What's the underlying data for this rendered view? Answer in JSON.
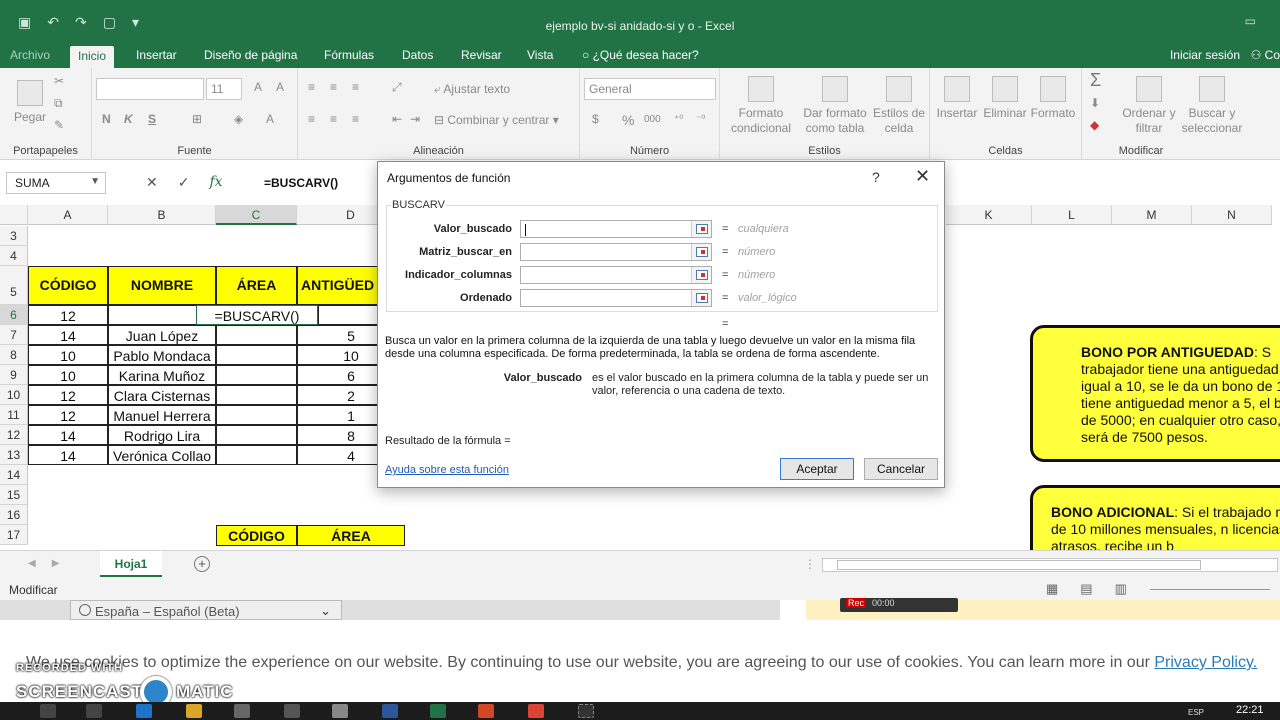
{
  "window": {
    "title": "ejemplo bv-si anidado-si y o - Excel"
  },
  "tabs": {
    "file": "Archivo",
    "items": [
      "Inicio",
      "Insertar",
      "Diseño de página",
      "Fórmulas",
      "Datos",
      "Revisar",
      "Vista",
      "¿Qué desea hacer?"
    ],
    "signin": "Iniciar sesión",
    "share": "Co"
  },
  "ribbon": {
    "clipboard": {
      "paste": "Pegar",
      "label": "Portapapeles"
    },
    "font": {
      "size": "11",
      "label": "Fuente",
      "bold": "N",
      "italic": "K",
      "underline": "S"
    },
    "alignment": {
      "wrap": "Ajustar texto",
      "merge": "Combinar y centrar",
      "label": "Alineación"
    },
    "number": {
      "format": "General",
      "label": "Número",
      "percent": "%",
      "thousands": "000"
    },
    "styles": {
      "conditional": "Formato condicional",
      "table": "Dar formato como tabla",
      "cell": "Estilos de celda",
      "label": "Estilos"
    },
    "cells": {
      "insert": "Insertar",
      "delete": "Eliminar",
      "format": "Formato",
      "label": "Celdas"
    },
    "editing": {
      "sort": "Ordenar y filtrar",
      "find": "Buscar y seleccionar",
      "label": "Modificar",
      "sum": "Σ"
    }
  },
  "formula_bar": {
    "name_box": "SUMA",
    "formula": "=BUSCARV()",
    "fx": "fx"
  },
  "sheet": {
    "columns": [
      "A",
      "B",
      "C",
      "D",
      "K",
      "L",
      "M",
      "N"
    ],
    "rows": [
      "3",
      "4",
      "5",
      "6",
      "7",
      "8",
      "9",
      "10",
      "11",
      "12",
      "13",
      "14",
      "15",
      "16",
      "17"
    ],
    "headers": [
      "CÓDIGO",
      "NOMBRE",
      "ÁREA",
      "ANTIGÜED"
    ],
    "editing_cell": "=BUSCARV()",
    "first_code": "12",
    "data": [
      {
        "codigo": "14",
        "nombre": "Juan López",
        "antiguedad": "5"
      },
      {
        "codigo": "10",
        "nombre": "Pablo Mondaca",
        "antiguedad": "10"
      },
      {
        "codigo": "10",
        "nombre": "Karina Muñoz",
        "antiguedad": "6"
      },
      {
        "codigo": "12",
        "nombre": "Clara Cisternas",
        "antiguedad": "2"
      },
      {
        "codigo": "12",
        "nombre": "Manuel Herrera",
        "antiguedad": "1"
      },
      {
        "codigo": "14",
        "nombre": "Rodrigo Lira",
        "antiguedad": "8"
      },
      {
        "codigo": "14",
        "nombre": "Verónica Collao",
        "antiguedad": "4"
      }
    ],
    "lookup_headers": [
      "CÓDIGO",
      "ÁREA"
    ],
    "bono1": {
      "title": "BONO POR ANTIGUEDAD",
      "text": ": S trabajador tiene una antiguedad m igual a 10, se le da un bono de 10 tiene antiguedad menor a 5, el bon de 5000; en cualquier otro caso, e será de 7500 pesos."
    },
    "bono2": {
      "title": "BONO ADICIONAL",
      "text": ": Si el trabajado más de 10 millones mensuales, n licencias ni atrasos, recibe un b"
    },
    "tab_name": "Hoja1"
  },
  "status": {
    "mode": "Modificar"
  },
  "dialog": {
    "title": "Argumentos de función",
    "help": "?",
    "function_name": "BUSCARV",
    "args": [
      {
        "label": "Valor_buscado",
        "hint": "cualquiera"
      },
      {
        "label": "Matriz_buscar_en",
        "hint": "número"
      },
      {
        "label": "Indicador_columnas",
        "hint": "número"
      },
      {
        "label": "Ordenado",
        "hint": "valor_lógico"
      }
    ],
    "equals": "=",
    "description": "Busca un valor en la primera columna de la izquierda de una tabla y luego devuelve un valor en la misma fila desde una columna especificada. De forma predeterminada, la tabla se ordena de forma ascendente.",
    "param_name": "Valor_buscado",
    "param_desc": "es el valor buscado en la primera columna de la tabla y puede ser un valor, referencia o una cadena de texto.",
    "result_label": "Resultado de la fórmula =",
    "help_link": "Ayuda sobre esta función",
    "ok": "Aceptar",
    "cancel": "Cancelar"
  },
  "overlay": {
    "language": "España – Español (Beta)",
    "cookie_text": "We use cookies to optimize the experience on our website. By continuing to use our website, you are agreeing to our use of cookies. You can learn more in our ",
    "cookie_link": "Privacy Policy.",
    "watermark_top": "RECORDED WITH",
    "watermark_left": "SCREENCAST",
    "watermark_right": "MATIC",
    "rec": "Rec",
    "rec_time": "00:00"
  },
  "taskbar": {
    "lang": "ESP",
    "time": "22:21"
  }
}
